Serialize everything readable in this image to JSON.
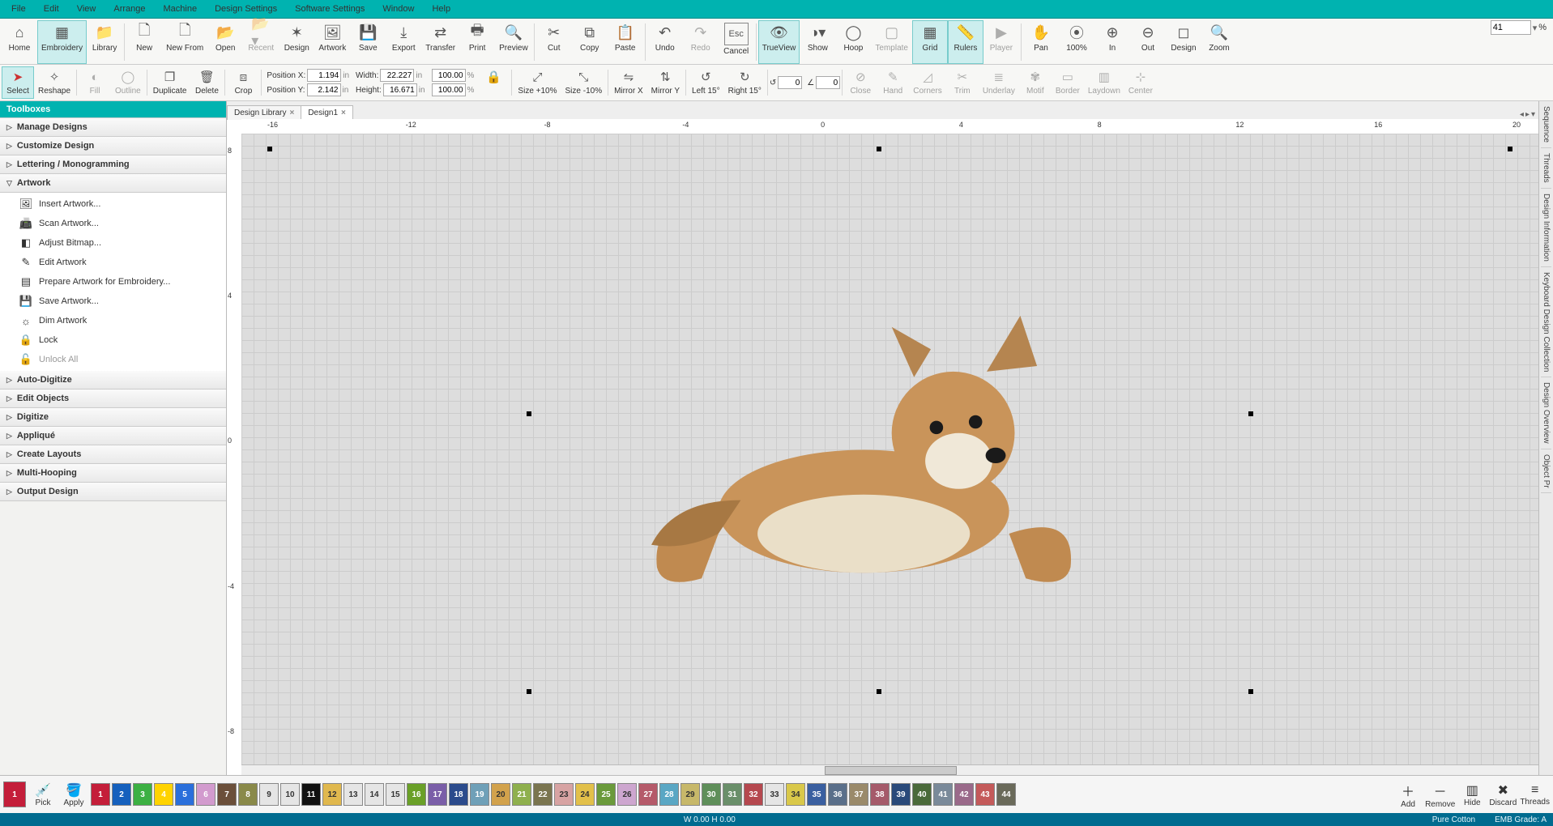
{
  "menu": {
    "file": "File",
    "edit": "Edit",
    "view": "View",
    "arrange": "Arrange",
    "machine": "Machine",
    "design_settings": "Design Settings",
    "software_settings": "Software Settings",
    "window": "Window",
    "help": "Help"
  },
  "ribbon1": {
    "home": "Home",
    "embroidery": "Embroidery",
    "library": "Library",
    "new": "New",
    "newfrom": "New From",
    "open": "Open",
    "recent": "Recent",
    "design": "Design",
    "artwork": "Artwork",
    "save": "Save",
    "export": "Export",
    "transfer": "Transfer",
    "print": "Print",
    "preview": "Preview",
    "cut": "Cut",
    "copy": "Copy",
    "paste": "Paste",
    "undo": "Undo",
    "redo": "Redo",
    "cancel": "Cancel",
    "trueview": "TrueView",
    "show": "Show",
    "hoop": "Hoop",
    "template": "Template",
    "grid": "Grid",
    "rulers": "Rulers",
    "player": "Player",
    "pan": "Pan",
    "p100": "100%",
    "zin": "In",
    "zout": "Out",
    "zdesign": "Design",
    "zoom": "Zoom",
    "zoomval": "41",
    "zoomunit": "%"
  },
  "ribbon2": {
    "select": "Select",
    "reshape": "Reshape",
    "fill": "Fill",
    "outline": "Outline",
    "duplicate": "Duplicate",
    "delete": "Delete",
    "crop": "Crop",
    "posx_l": "Position X:",
    "posx_v": "1.194",
    "posy_l": "Position Y:",
    "posy_v": "2.142",
    "unit_in": "in",
    "w_l": "Width:",
    "w_v": "22.227",
    "h_l": "Height:",
    "h_v": "16.671",
    "wp": "100.00",
    "hp": "100.00",
    "pct": "%",
    "s10p": "Size +10%",
    "s10m": "Size -10%",
    "mirx": "Mirror X",
    "miry": "Mirror Y",
    "l15": "Left 15°",
    "r15": "Right 15°",
    "rot1": "0",
    "rot2": "0",
    "close": "Close",
    "hand": "Hand",
    "corners": "Corners",
    "trim": "Trim",
    "underlay": "Underlay",
    "motif": "Motif",
    "border": "Border",
    "laydown": "Laydown",
    "center": "Center"
  },
  "side": {
    "title": "Toolboxes",
    "manage": "Manage Designs",
    "customize": "Customize Design",
    "letter": "Lettering / Monogramming",
    "artwork": "Artwork",
    "art_items": {
      "insert": "Insert Artwork...",
      "scan": "Scan Artwork...",
      "adjust": "Adjust Bitmap...",
      "edit": "Edit Artwork",
      "prepare": "Prepare Artwork for Embroidery...",
      "save": "Save Artwork...",
      "dim": "Dim Artwork",
      "lock": "Lock",
      "unlock": "Unlock All"
    },
    "auto": "Auto-Digitize",
    "editobj": "Edit Objects",
    "digit": "Digitize",
    "appl": "Appliqué",
    "layouts": "Create Layouts",
    "multi": "Multi-Hooping",
    "output": "Output Design"
  },
  "tabs": {
    "t1": "Design Library",
    "t2": "Design1"
  },
  "ruler_h": [
    "-16",
    "-12",
    "-8",
    "-4",
    "0",
    "4",
    "8",
    "12",
    "16",
    "20"
  ],
  "ruler_v": [
    "8",
    "4",
    "0",
    "-4",
    "-8"
  ],
  "rightstrip": [
    "Sequence",
    "Threads",
    "Design Information",
    "Keyboard Design Collection",
    "Design Overview",
    "Object Pr"
  ],
  "palette": {
    "pick": "Pick",
    "apply": "Apply",
    "add": "Add",
    "remove": "Remove",
    "hide": "Hide",
    "discard": "Discard",
    "threads": "Threads",
    "main": "1",
    "colors": [
      {
        "n": "1",
        "c": "#c41e3a"
      },
      {
        "n": "2",
        "c": "#1560bd"
      },
      {
        "n": "3",
        "c": "#3cb043"
      },
      {
        "n": "4",
        "c": "#ffd300"
      },
      {
        "n": "5",
        "c": "#2a6fdb"
      },
      {
        "n": "6",
        "c": "#d29bce"
      },
      {
        "n": "7",
        "c": "#6b4f3a"
      },
      {
        "n": "8",
        "c": "#8a8a4a"
      },
      {
        "n": "9",
        "c": "#e5e5e5",
        "t": "#333"
      },
      {
        "n": "10",
        "c": "#e5e5e5",
        "t": "#333"
      },
      {
        "n": "11",
        "c": "#111"
      },
      {
        "n": "12",
        "c": "#e0b84e",
        "t": "#333"
      },
      {
        "n": "13",
        "c": "#e5e5e5",
        "t": "#333"
      },
      {
        "n": "14",
        "c": "#e5e5e5",
        "t": "#333"
      },
      {
        "n": "15",
        "c": "#e5e5e5",
        "t": "#333"
      },
      {
        "n": "16",
        "c": "#6aa028"
      },
      {
        "n": "17",
        "c": "#7a5ea8"
      },
      {
        "n": "18",
        "c": "#2b4b8c"
      },
      {
        "n": "19",
        "c": "#6fa0b8"
      },
      {
        "n": "20",
        "c": "#d2a24c",
        "t": "#333"
      },
      {
        "n": "21",
        "c": "#8fb04e"
      },
      {
        "n": "22",
        "c": "#7a7550"
      },
      {
        "n": "23",
        "c": "#d7a3a3",
        "t": "#333"
      },
      {
        "n": "24",
        "c": "#e2c04a",
        "t": "#333"
      },
      {
        "n": "25",
        "c": "#6a9a3b"
      },
      {
        "n": "26",
        "c": "#cda6cf",
        "t": "#333"
      },
      {
        "n": "27",
        "c": "#b55a6a"
      },
      {
        "n": "28",
        "c": "#5aa7c4"
      },
      {
        "n": "29",
        "c": "#c7b86a",
        "t": "#333"
      },
      {
        "n": "30",
        "c": "#5f8f5a"
      },
      {
        "n": "31",
        "c": "#6a8f6a"
      },
      {
        "n": "32",
        "c": "#b5484f"
      },
      {
        "n": "33",
        "c": "#e5e5e5",
        "t": "#333"
      },
      {
        "n": "34",
        "c": "#d9c84a",
        "t": "#333"
      },
      {
        "n": "35",
        "c": "#3a5fa0"
      },
      {
        "n": "36",
        "c": "#5a6f8a"
      },
      {
        "n": "37",
        "c": "#9a8a6a"
      },
      {
        "n": "38",
        "c": "#a55a6a"
      },
      {
        "n": "39",
        "c": "#2a4a7a"
      },
      {
        "n": "40",
        "c": "#4a6a3a"
      },
      {
        "n": "41",
        "c": "#7a8a9a"
      },
      {
        "n": "42",
        "c": "#9a6a8a"
      },
      {
        "n": "43",
        "c": "#c45a5a"
      },
      {
        "n": "44",
        "c": "#6a6a5a"
      }
    ]
  },
  "status": {
    "wh": "W 0.00 H 0.00",
    "fabric": "Pure Cotton",
    "grade": "EMB Grade: A"
  }
}
